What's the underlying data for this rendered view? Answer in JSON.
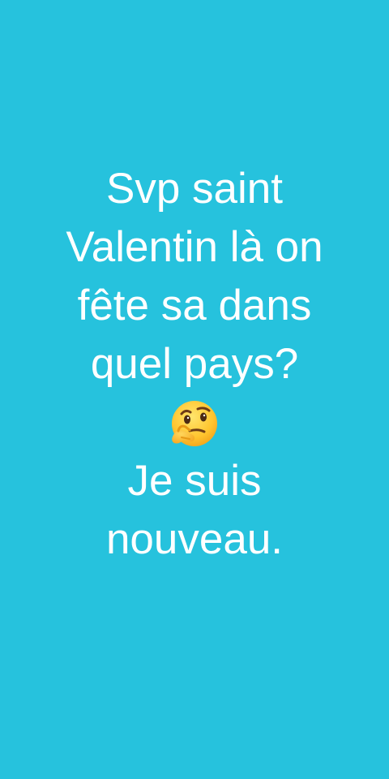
{
  "status": {
    "background_color": "#26c2dd",
    "text_color": "#ffffff",
    "lines_before_emoji": [
      "Svp saint",
      "Valentin là on",
      "fête sa dans",
      "quel pays?"
    ],
    "emoji": "thinking-face-icon",
    "lines_after_emoji": [
      "Je suis",
      "nouveau."
    ]
  }
}
